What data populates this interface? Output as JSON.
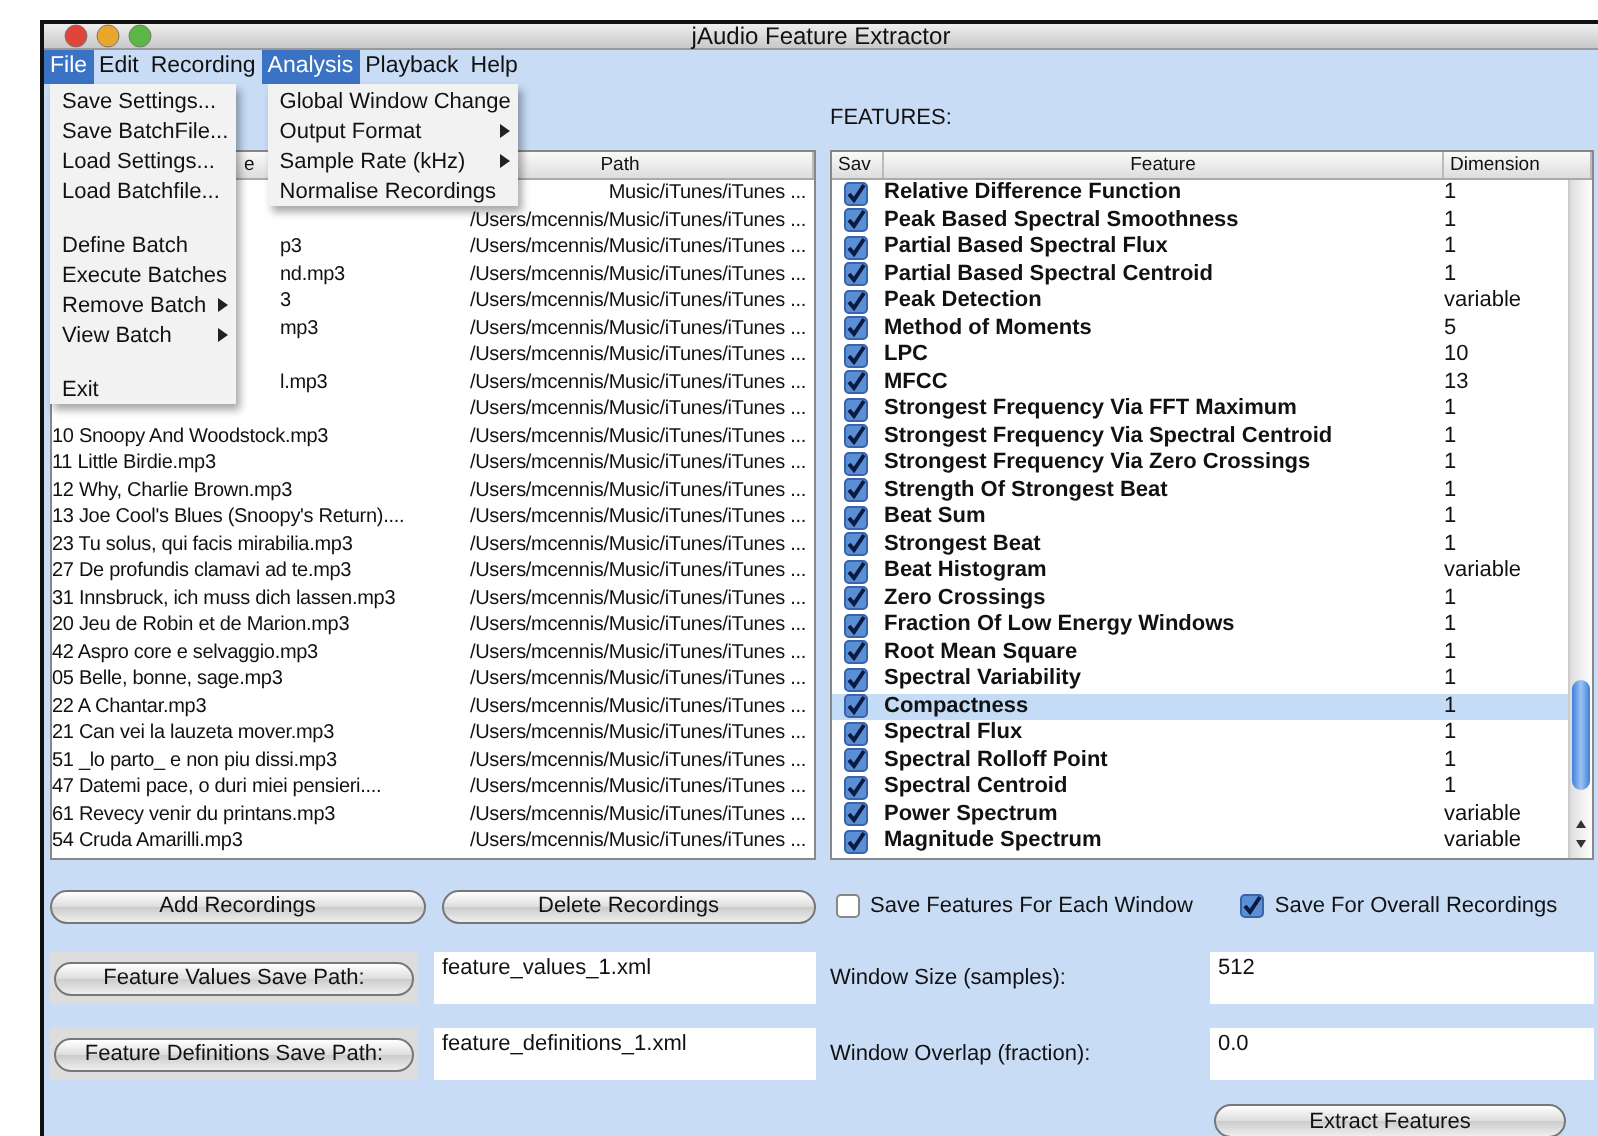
{
  "window": {
    "title": "jAudio Feature Extractor"
  },
  "menu_bar": [
    {
      "label": "File",
      "selected": true,
      "menu": [
        {
          "label": "Save Settings...",
          "submenu": false
        },
        {
          "label": "Save BatchFile...",
          "submenu": false
        },
        {
          "label": "Load Settings...",
          "submenu": false
        },
        {
          "label": "Load Batchfile...",
          "submenu": false
        },
        {
          "kind": "gap"
        },
        {
          "label": "Define Batch",
          "submenu": false
        },
        {
          "label": "Execute Batches",
          "submenu": false
        },
        {
          "label": "Remove Batch",
          "submenu": true
        },
        {
          "label": "View Batch",
          "submenu": true
        },
        {
          "kind": "gap"
        },
        {
          "label": "Exit",
          "submenu": false
        }
      ]
    },
    {
      "label": "Edit",
      "selected": false
    },
    {
      "label": "Recording",
      "selected": false
    },
    {
      "label": "Analysis",
      "selected": true,
      "menu": [
        {
          "label": "Global Window Change",
          "submenu": false
        },
        {
          "label": "Output Format",
          "submenu": true
        },
        {
          "label": "Sample Rate (kHz)",
          "submenu": true
        },
        {
          "label": "Normalise Recordings",
          "submenu": false
        }
      ]
    },
    {
      "label": "Playback",
      "selected": false
    },
    {
      "label": "Help",
      "selected": false
    }
  ],
  "recordings": {
    "header": {
      "name": "e",
      "path": "Path"
    },
    "covered_rows": [
      {
        "path": "Music/iTunes/iTunes ..."
      },
      {
        "path": "/Users/mcennis/Music/iTunes/iTunes ..."
      },
      {
        "name": "p3",
        "path": "/Users/mcennis/Music/iTunes/iTunes ..."
      },
      {
        "name": "nd.mp3",
        "path": "/Users/mcennis/Music/iTunes/iTunes ..."
      },
      {
        "name": "3",
        "path": "/Users/mcennis/Music/iTunes/iTunes ..."
      },
      {
        "name": "mp3",
        "path": "/Users/mcennis/Music/iTunes/iTunes ..."
      },
      {
        "path": "/Users/mcennis/Music/iTunes/iTunes ..."
      },
      {
        "name": "l.mp3",
        "path": "/Users/mcennis/Music/iTunes/iTunes ..."
      },
      {
        "path": "/Users/mcennis/Music/iTunes/iTunes ..."
      }
    ],
    "rows": [
      {
        "name": "10 Snoopy And Woodstock.mp3",
        "path": "/Users/mcennis/Music/iTunes/iTunes ..."
      },
      {
        "name": "11 Little Birdie.mp3",
        "path": "/Users/mcennis/Music/iTunes/iTunes ..."
      },
      {
        "name": "12 Why, Charlie Brown.mp3",
        "path": "/Users/mcennis/Music/iTunes/iTunes ..."
      },
      {
        "name": "13 Joe Cool's Blues (Snoopy's Return)....",
        "path": "/Users/mcennis/Music/iTunes/iTunes ..."
      },
      {
        "name": "23 Tu solus, qui facis mirabilia.mp3",
        "path": "/Users/mcennis/Music/iTunes/iTunes ..."
      },
      {
        "name": "27 De profundis clamavi ad te.mp3",
        "path": "/Users/mcennis/Music/iTunes/iTunes ..."
      },
      {
        "name": "31 Innsbruck, ich muss dich lassen.mp3",
        "path": "/Users/mcennis/Music/iTunes/iTunes ..."
      },
      {
        "name": "20 Jeu de Robin et de Marion.mp3",
        "path": "/Users/mcennis/Music/iTunes/iTunes ..."
      },
      {
        "name": "42 Aspro core e selvaggio.mp3",
        "path": "/Users/mcennis/Music/iTunes/iTunes ..."
      },
      {
        "name": "05 Belle, bonne, sage.mp3",
        "path": "/Users/mcennis/Music/iTunes/iTunes ..."
      },
      {
        "name": "22 A Chantar.mp3",
        "path": "/Users/mcennis/Music/iTunes/iTunes ..."
      },
      {
        "name": "21 Can vei la lauzeta mover.mp3",
        "path": "/Users/mcennis/Music/iTunes/iTunes ..."
      },
      {
        "name": "51 _lo parto_ e non piu dissi.mp3",
        "path": "/Users/mcennis/Music/iTunes/iTunes ..."
      },
      {
        "name": "47 Datemi pace, o duri miei pensieri....",
        "path": "/Users/mcennis/Music/iTunes/iTunes ..."
      },
      {
        "name": "61 Revecy venir du printans.mp3",
        "path": "/Users/mcennis/Music/iTunes/iTunes ..."
      },
      {
        "name": "54 Cruda Amarilli.mp3",
        "path": "/Users/mcennis/Music/iTunes/iTunes ..."
      }
    ]
  },
  "record_buttons": [
    "Add Recordings",
    "Delete Recordings"
  ],
  "save_paths": [
    {
      "button": "Feature Values Save Path:",
      "value": "feature_values_1.xml"
    },
    {
      "button": "Feature Definitions Save Path:",
      "value": "feature_definitions_1.xml"
    }
  ],
  "features_label": "FEATURES:",
  "features": {
    "columns": [
      "Sav",
      "Feature",
      "Dimension"
    ],
    "rows": [
      {
        "name": "Relative Difference Function",
        "dimension": "1",
        "checked": true,
        "selected": false
      },
      {
        "name": "Peak Based Spectral Smoothness",
        "dimension": "1",
        "checked": true,
        "selected": false
      },
      {
        "name": "Partial Based Spectral Flux",
        "dimension": "1",
        "checked": true,
        "selected": false
      },
      {
        "name": "Partial Based Spectral Centroid",
        "dimension": "1",
        "checked": true,
        "selected": false
      },
      {
        "name": "Peak Detection",
        "dimension": "variable",
        "checked": true,
        "selected": false
      },
      {
        "name": "Method of Moments",
        "dimension": "5",
        "checked": true,
        "selected": false
      },
      {
        "name": "LPC",
        "dimension": "10",
        "checked": true,
        "selected": false
      },
      {
        "name": "MFCC",
        "dimension": "13",
        "checked": true,
        "selected": false
      },
      {
        "name": "Strongest Frequency Via FFT Maximum",
        "dimension": "1",
        "checked": true,
        "selected": false
      },
      {
        "name": "Strongest Frequency Via Spectral Centroid",
        "dimension": "1",
        "checked": true,
        "selected": false
      },
      {
        "name": "Strongest Frequency Via Zero Crossings",
        "dimension": "1",
        "checked": true,
        "selected": false
      },
      {
        "name": "Strength Of Strongest Beat",
        "dimension": "1",
        "checked": true,
        "selected": false
      },
      {
        "name": "Beat Sum",
        "dimension": "1",
        "checked": true,
        "selected": false
      },
      {
        "name": "Strongest Beat",
        "dimension": "1",
        "checked": true,
        "selected": false
      },
      {
        "name": "Beat Histogram",
        "dimension": "variable",
        "checked": true,
        "selected": false
      },
      {
        "name": "Zero Crossings",
        "dimension": "1",
        "checked": true,
        "selected": false
      },
      {
        "name": "Fraction Of Low Energy Windows",
        "dimension": "1",
        "checked": true,
        "selected": false
      },
      {
        "name": "Root Mean Square",
        "dimension": "1",
        "checked": true,
        "selected": false
      },
      {
        "name": "Spectral Variability",
        "dimension": "1",
        "checked": true,
        "selected": false
      },
      {
        "name": "Compactness",
        "dimension": "1",
        "checked": true,
        "selected": true
      },
      {
        "name": "Spectral Flux",
        "dimension": "1",
        "checked": true,
        "selected": false
      },
      {
        "name": "Spectral Rolloff Point",
        "dimension": "1",
        "checked": true,
        "selected": false
      },
      {
        "name": "Spectral Centroid",
        "dimension": "1",
        "checked": true,
        "selected": false
      },
      {
        "name": "Power Spectrum",
        "dimension": "variable",
        "checked": true,
        "selected": false
      },
      {
        "name": "Magnitude Spectrum",
        "dimension": "variable",
        "checked": true,
        "selected": false
      }
    ]
  },
  "save_options": [
    {
      "label": "Save Features For Each Window",
      "checked": false
    },
    {
      "label": "Save For Overall Recordings",
      "checked": true
    }
  ],
  "window_fields": [
    {
      "label": "Window Size (samples):",
      "value": "512"
    },
    {
      "label": "Window Overlap (fraction):",
      "value": "0.0"
    }
  ],
  "extract_button": "Extract Features"
}
